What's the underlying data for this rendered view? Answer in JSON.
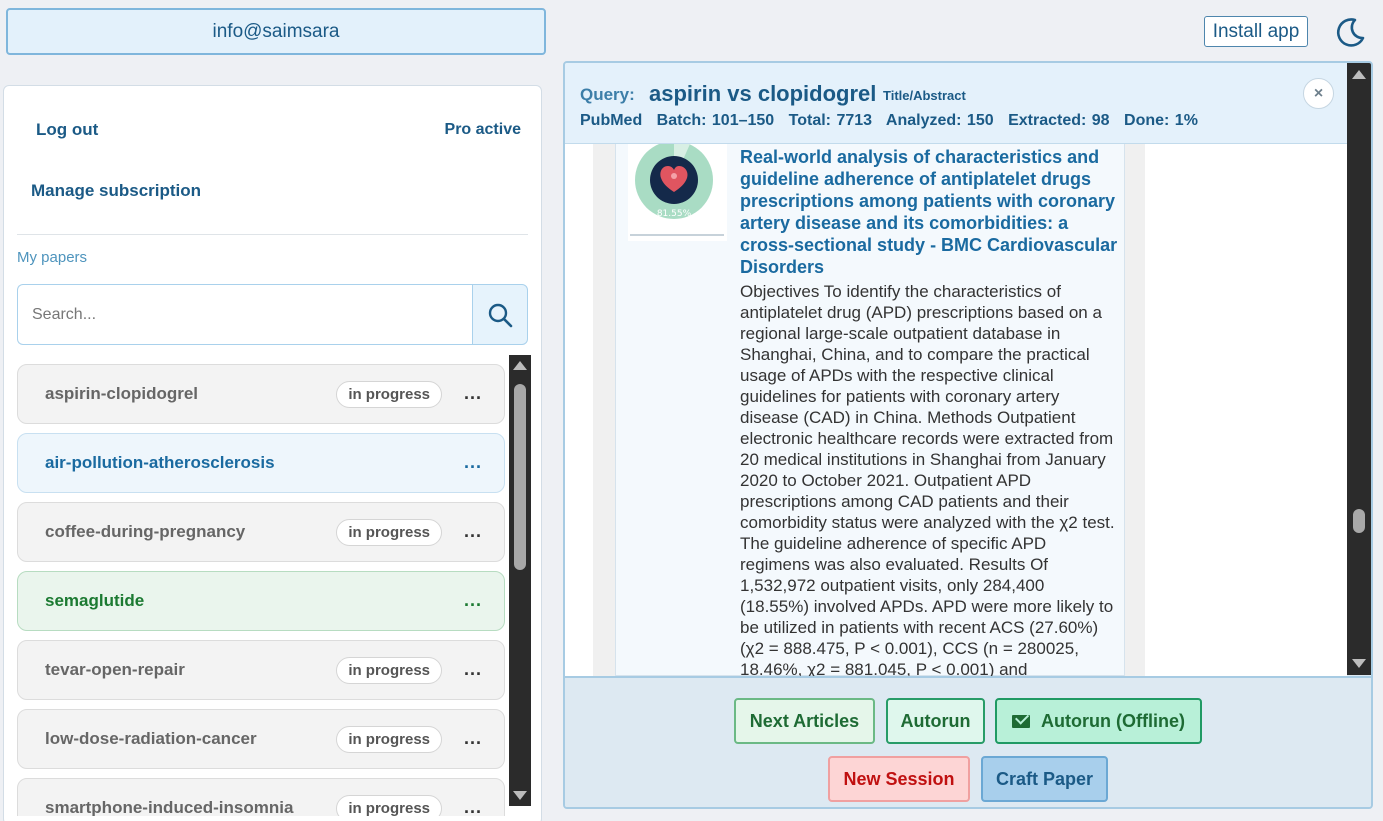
{
  "account": {
    "email": "info@saimsara"
  },
  "left_panel": {
    "logout_label": "Log out",
    "plan_label": "Pro active",
    "manage_label": "Manage subscription",
    "my_papers_label": "My papers",
    "search": {
      "placeholder": "Search..."
    },
    "papers": [
      {
        "name": "aspirin-clopidogrel",
        "status": "in progress",
        "menu": "...",
        "variant": "default"
      },
      {
        "name": "air-pollution-atherosclerosis",
        "status": "",
        "menu": "...",
        "variant": "active-blue"
      },
      {
        "name": "coffee-during-pregnancy",
        "status": "in progress",
        "menu": "...",
        "variant": "default"
      },
      {
        "name": "semaglutide",
        "status": "",
        "menu": "...",
        "variant": "active-green"
      },
      {
        "name": "tevar-open-repair",
        "status": "in progress",
        "menu": "...",
        "variant": "default"
      },
      {
        "name": "low-dose-radiation-cancer",
        "status": "in progress",
        "menu": "...",
        "variant": "default"
      },
      {
        "name": "smartphone-induced-insomnia",
        "status": "in progress",
        "menu": "...",
        "variant": "default"
      }
    ]
  },
  "top_right": {
    "install_label": "Install app",
    "theme_icon": "moon-icon"
  },
  "session": {
    "query_label": "Query:",
    "query_text": "aspirin vs clopidogrel",
    "query_scope": "Title/Abstract",
    "source": "PubMed",
    "batch": "Batch: 101–150",
    "total": "Total: 7713",
    "analyzed": "Analyzed: 150",
    "extracted": "Extracted: 98",
    "done": "Done: 1%",
    "close_label": "×"
  },
  "article": {
    "title": "Real-world analysis of characteristics and guideline adherence of antiplatelet drugs prescriptions among patients with coronary artery disease and its comorbidities: a cross-sectional study - BMC Cardiovascular Disorders",
    "abstract": "Objectives To identify the characteristics of antiplatelet drug (APD) prescriptions based on a regional large-scale outpatient database in Shanghai, China, and to compare the practical usage of APDs with the respective clinical guidelines for patients with coronary artery disease (CAD) in China. Methods Outpatient electronic healthcare records were extracted from 20 medical institutions in Shanghai from January 2020 to October 2021. Outpatient APD prescriptions among CAD patients and their comorbidity status were analyzed with the χ2 test. The guideline adherence of specific APD regimens was also evaluated. Results Of 1,532,972 outpatient visits, only 284,400 (18.55%) involved APDs. APD were more likely to be utilized in patients with recent ACS (27.60%) (χ2 = 888.475, P < 0.001), CCS (n = 280025, 18.46%, χ2 = 881.045, P < 0.001) and",
    "thumbnail_label": "81.55%"
  },
  "actions": {
    "next_label": "Next Articles",
    "autorun_label": "Autorun",
    "autorun_offline_label": "Autorun (Offline)",
    "new_session_label": "New Session",
    "craft_paper_label": "Craft Paper"
  },
  "colors": {
    "primary": "#1b5a86",
    "accent_green": "#1e6b34",
    "accent_red": "#c01010"
  }
}
